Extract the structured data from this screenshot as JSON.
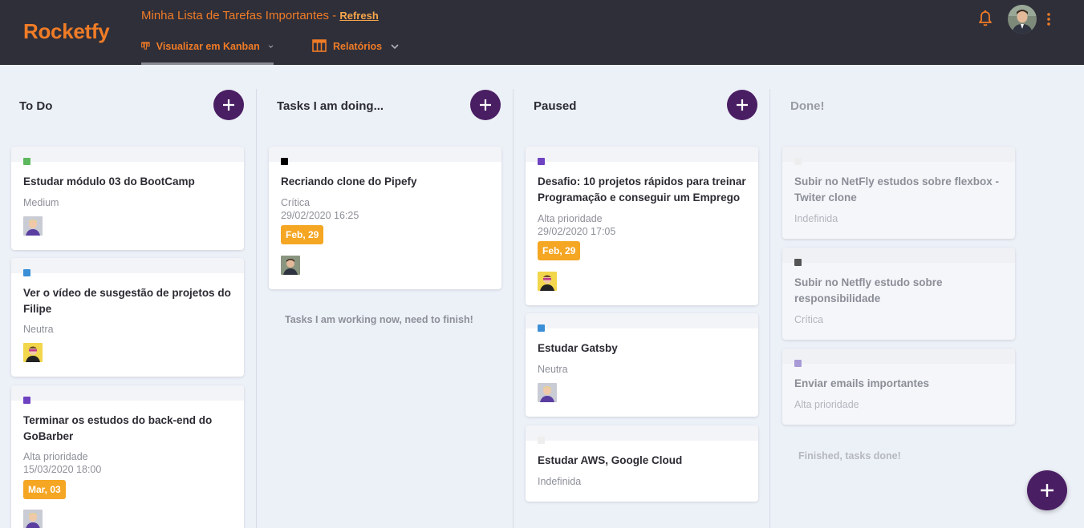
{
  "header": {
    "logo": "Rocketfy",
    "board_title": "Minha Lista de Tarefas Importantes - ",
    "refresh_label": "Refresh",
    "tabs": [
      {
        "label": "Visualizar em Kanban",
        "icon": "kanban-icon"
      },
      {
        "label": "Relatórios",
        "icon": "table-icon"
      }
    ]
  },
  "colors": {
    "accent": "#f07c26",
    "header_bg": "#2f2f3a",
    "board_bg": "#ecf0f7",
    "purple_button": "#4a1e63",
    "due_badge": "#f5a623"
  },
  "columns": [
    {
      "title": "To Do",
      "cards": [
        {
          "title": "Estudar módulo 03 do BootCamp",
          "priority": "Medium",
          "tag_color": "#5cb85c"
        },
        {
          "title": "Ver o vídeo de susgestão de projetos do Filipe",
          "priority": "Neutra",
          "tag_color": "#3a8fd6"
        },
        {
          "title": "Terminar os estudos do back-end do GoBarber",
          "priority": "Alta prioridade",
          "datetime": "15/03/2020 18:00",
          "due": "Mar, 03",
          "tag_color": "#6f42c1"
        }
      ]
    },
    {
      "title": "Tasks I am doing...",
      "cards": [
        {
          "title": "Recriando clone do Pipefy",
          "priority": "Crítica",
          "datetime": "29/02/2020 16:25",
          "due": "Feb, 29",
          "tag_color": "#000000"
        }
      ],
      "note": "Tasks I am working now, need to finish!"
    },
    {
      "title": "Paused",
      "cards": [
        {
          "title": "Desafio: 10 projetos rápidos para treinar Programação e conseguir um Emprego",
          "priority": "Alta prioridade",
          "datetime": "29/02/2020 17:05",
          "due": "Feb, 29",
          "tag_color": "#6f42c1"
        },
        {
          "title": "Estudar Gatsby",
          "priority": "Neutra",
          "tag_color": "#3a8fd6"
        },
        {
          "title": "Estudar AWS, Google Cloud",
          "priority": "Indefinida",
          "tag_color": "#eeeeee"
        }
      ]
    },
    {
      "title": "Done!",
      "cards": [
        {
          "title": "Subir no NetFly estudos sobre flexbox - Twiter clone",
          "priority": "Indefinida",
          "tag_color": "#eeeeee"
        },
        {
          "title": "Subir no Netfly estudo sobre responsibilidade",
          "priority": "Crítica",
          "tag_color": "#555555"
        },
        {
          "title": "Enviar emails importantes",
          "priority": "Alta prioridade",
          "tag_color": "#a89ad6"
        }
      ],
      "note": "Finished, tasks done!"
    }
  ]
}
